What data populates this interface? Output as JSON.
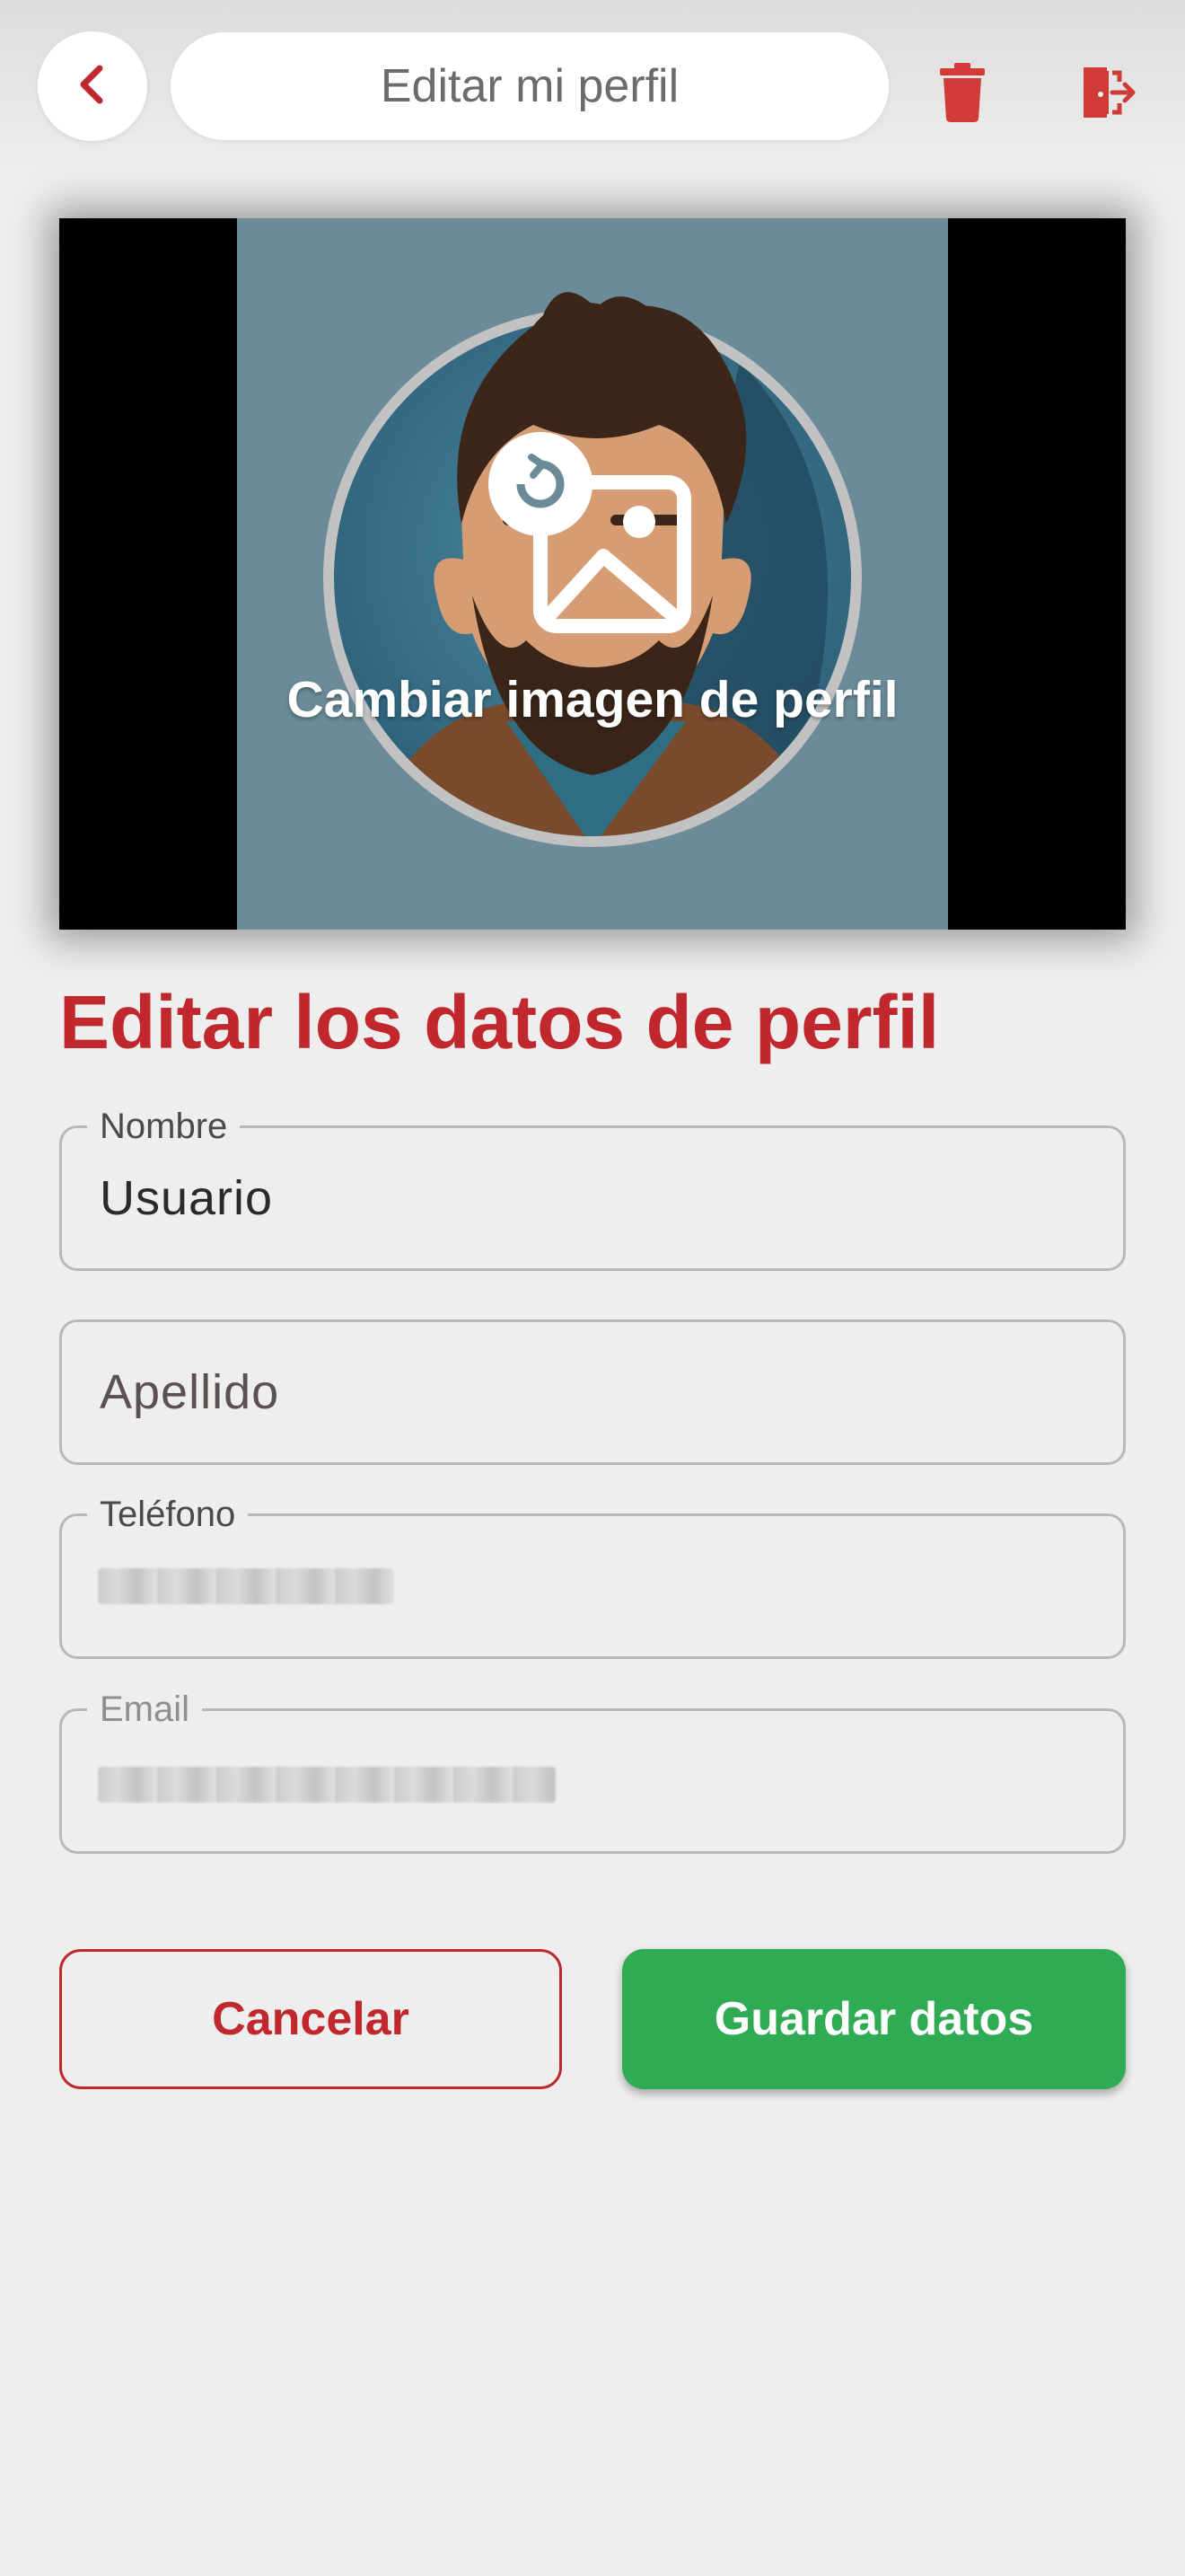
{
  "header": {
    "title": "Editar mi perfil",
    "back_icon": "chevron-left-icon",
    "delete_icon": "trash-icon",
    "logout_icon": "logout-icon"
  },
  "profile_image": {
    "change_label": "Cambiar imagen de perfil",
    "change_icon": "change-image-icon"
  },
  "form": {
    "title": "Editar los datos de perfil",
    "nombre": {
      "label": "Nombre",
      "value": "Usuario"
    },
    "apellido": {
      "placeholder": "Apellido"
    },
    "telefono": {
      "label": "Teléfono"
    },
    "email": {
      "label": "Email"
    }
  },
  "actions": {
    "cancel_label": "Cancelar",
    "save_label": "Guardar datos"
  },
  "colors": {
    "accent_red": "#c0282d",
    "save_green": "#2fac53",
    "background": "#eeeeee"
  }
}
